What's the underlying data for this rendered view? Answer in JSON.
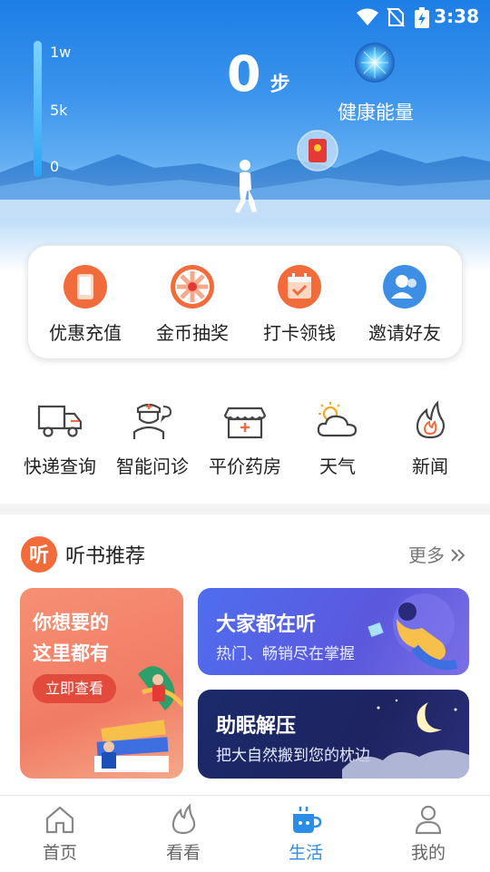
{
  "status_bar": {
    "time": "3:38"
  },
  "hero": {
    "gauge_labels": [
      "1w",
      "5k",
      "0"
    ],
    "steps_value": "0",
    "steps_unit": "步",
    "energy_label": "健康能量"
  },
  "quick_actions": [
    {
      "label": "优惠充值",
      "icon": "tablet-icon"
    },
    {
      "label": "金币抽奖",
      "icon": "lucky-wheel-icon"
    },
    {
      "label": "打卡领钱",
      "icon": "calendar-check-icon"
    },
    {
      "label": "邀请好友",
      "icon": "user-invite-icon"
    }
  ],
  "services": [
    {
      "label": "快递查询",
      "icon": "truck-icon"
    },
    {
      "label": "智能问诊",
      "icon": "doctor-icon"
    },
    {
      "label": "平价药房",
      "icon": "pharmacy-icon"
    },
    {
      "label": "天气",
      "icon": "weather-icon"
    },
    {
      "label": "新闻",
      "icon": "fire-icon"
    }
  ],
  "audiobook_section": {
    "logo_text": "听",
    "title": "听书推荐",
    "more": "更多"
  },
  "promo_card": {
    "line1": "你想要的",
    "line2": "这里都有",
    "button": "立即查看"
  },
  "tiles": [
    {
      "title": "大家都在听",
      "subtitle": "热门、畅销尽在掌握"
    },
    {
      "title": "助眠解压",
      "subtitle": "把大自然搬到您的枕边"
    }
  ],
  "tabbar": [
    {
      "label": "首页",
      "icon": "home-icon",
      "active": false
    },
    {
      "label": "看看",
      "icon": "flame-outline-icon",
      "active": false
    },
    {
      "label": "生活",
      "icon": "cup-icon",
      "active": true
    },
    {
      "label": "我的",
      "icon": "person-icon",
      "active": false
    }
  ],
  "colors": {
    "accent": "#2a8ee8",
    "orange": "#f26b3a",
    "promo": "#f17b64"
  }
}
